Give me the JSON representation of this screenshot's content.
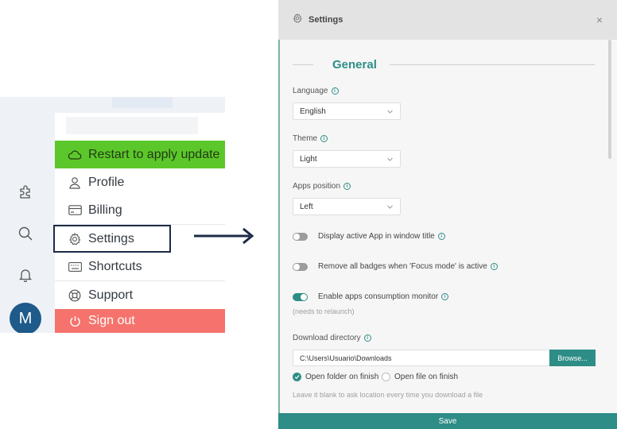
{
  "app_menu": {
    "avatar_initial": "M",
    "items": [
      {
        "label": "Restart to apply update",
        "icon": "cloud-icon"
      },
      {
        "label": "Profile",
        "icon": "user-icon"
      },
      {
        "label": "Billing",
        "icon": "credit-card-icon"
      },
      {
        "label": "Settings",
        "icon": "gear-icon"
      },
      {
        "label": "Shortcuts",
        "icon": "keyboard-icon"
      },
      {
        "label": "Support",
        "icon": "lifebuoy-icon"
      },
      {
        "label": "Sign out",
        "icon": "power-icon"
      }
    ],
    "sidebar_icons": [
      "puzzle-icon",
      "search-icon",
      "bell-icon"
    ],
    "colors": {
      "restart_bg": "#5cc72a",
      "signout_bg": "#f5736c",
      "highlight_border": "#1c2b46"
    }
  },
  "settings": {
    "title": "Settings",
    "close_glyph": "×",
    "section_title": "General",
    "language": {
      "label": "Language",
      "value": "English"
    },
    "theme": {
      "label": "Theme",
      "value": "Light"
    },
    "apps_position": {
      "label": "Apps position",
      "value": "Left"
    },
    "toggles": [
      {
        "label": "Display active App in window title",
        "on": false
      },
      {
        "label": "Remove all badges when 'Focus mode' is active",
        "on": false
      },
      {
        "label": "Enable apps consumption monitor",
        "on": true
      }
    ],
    "consumption_hint": "(needs to relaunch)",
    "download": {
      "label": "Download directory",
      "value": "C:\\Users\\Usuario\\Downloads",
      "browse_label": "Browse...",
      "open_folder_label": "Open folder on finish",
      "open_folder_checked": true,
      "open_file_label": "Open file on finish",
      "open_file_checked": false,
      "hint": "Leave it blank to ask location every time you download a file"
    },
    "save_label": "Save",
    "colors": {
      "accent": "#2e8d86"
    }
  }
}
